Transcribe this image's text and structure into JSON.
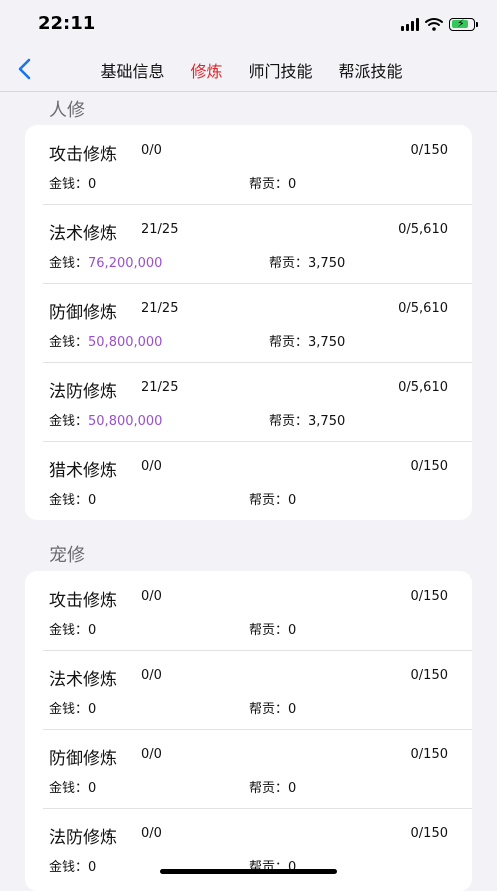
{
  "status_bar": {
    "time": "22:11"
  },
  "nav": {
    "tabs": [
      {
        "label": "基础信息",
        "active": false
      },
      {
        "label": "修炼",
        "active": true
      },
      {
        "label": "师门技能",
        "active": false
      },
      {
        "label": "帮派技能",
        "active": false
      }
    ]
  },
  "sections": [
    {
      "title": "人修",
      "items": [
        {
          "name": "攻击修炼",
          "level": "0/0",
          "progress": "0/150",
          "money_label": "金钱：",
          "money": "0",
          "contrib_label": "帮贡：",
          "contrib": "0"
        },
        {
          "name": "法术修炼",
          "level": "21/25",
          "progress": "0/5,610",
          "money_label": "金钱：",
          "money": "76,200,000",
          "contrib_label": "帮贡：",
          "contrib": "3,750"
        },
        {
          "name": "防御修炼",
          "level": "21/25",
          "progress": "0/5,610",
          "money_label": "金钱：",
          "money": "50,800,000",
          "contrib_label": "帮贡：",
          "contrib": "3,750"
        },
        {
          "name": "法防修炼",
          "level": "21/25",
          "progress": "0/5,610",
          "money_label": "金钱：",
          "money": "50,800,000",
          "contrib_label": "帮贡：",
          "contrib": "3,750"
        },
        {
          "name": "猎术修炼",
          "level": "0/0",
          "progress": "0/150",
          "money_label": "金钱：",
          "money": "0",
          "contrib_label": "帮贡：",
          "contrib": "0"
        }
      ]
    },
    {
      "title": "宠修",
      "items": [
        {
          "name": "攻击修炼",
          "level": "0/0",
          "progress": "0/150",
          "money_label": "金钱：",
          "money": "0",
          "contrib_label": "帮贡：",
          "contrib": "0"
        },
        {
          "name": "法术修炼",
          "level": "0/0",
          "progress": "0/150",
          "money_label": "金钱：",
          "money": "0",
          "contrib_label": "帮贡：",
          "contrib": "0"
        },
        {
          "name": "防御修炼",
          "level": "0/0",
          "progress": "0/150",
          "money_label": "金钱：",
          "money": "0",
          "contrib_label": "帮贡：",
          "contrib": "0"
        },
        {
          "name": "法防修炼",
          "level": "0/0",
          "progress": "0/150",
          "money_label": "金钱：",
          "money": "0",
          "contrib_label": "帮贡：",
          "contrib": "0"
        }
      ]
    }
  ],
  "colors": {
    "active_tab": "#e3262a",
    "money_highlight": "#9b4fd0",
    "battery": "#34c759",
    "back_arrow": "#1a73e8"
  },
  "icons": {
    "back": "chevron-left-icon",
    "signal": "cellular-signal-icon",
    "wifi": "wifi-icon",
    "battery": "battery-charging-icon"
  }
}
